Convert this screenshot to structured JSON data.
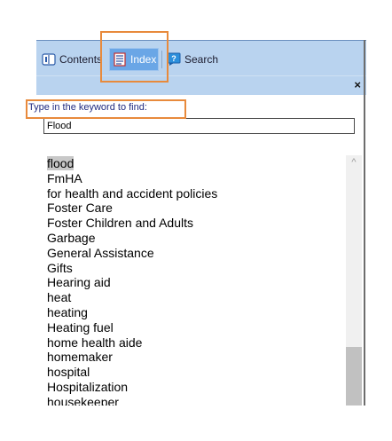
{
  "tabs": {
    "contents_label": "Contents",
    "index_label": "Index",
    "search_label": "Search",
    "active": "Index"
  },
  "toolbar": {
    "close_symbol": "×"
  },
  "index": {
    "prompt": "Type in the keyword to find:",
    "keyword_value": "Flood",
    "items": [
      "flood",
      "FmHA",
      "for health and accident policies",
      "Foster Care",
      "Foster Children and Adults",
      "Garbage",
      "General Assistance",
      "Gifts",
      "Hearing aid",
      "heat",
      "heating",
      "Heating fuel",
      "home health aide",
      "homemaker",
      "hospital",
      "Hospitalization",
      "housekeeper"
    ],
    "selected_item": "flood"
  },
  "scrollbar": {
    "up_arrow": "^",
    "position_fraction": 0.92
  },
  "colors": {
    "tabbar_bg": "#b9d3ef",
    "active_tab_bg": "#6aa6e6",
    "prompt_text": "#1f2a80",
    "highlight_outline": "#e88a3c"
  },
  "icons": [
    "book-icon",
    "index-page-icon",
    "search-help-icon"
  ]
}
